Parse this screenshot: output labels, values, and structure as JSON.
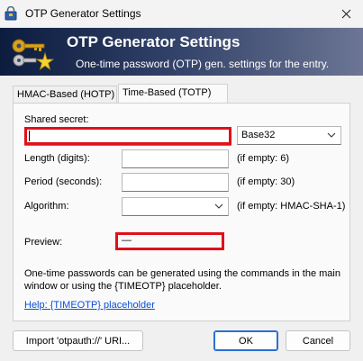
{
  "window": {
    "title": "OTP Generator Settings"
  },
  "banner": {
    "title": "OTP Generator Settings",
    "subtitle": "One-time password (OTP) gen. settings for the entry."
  },
  "tabs": [
    {
      "label": "HMAC-Based (HOTP)",
      "selected": false
    },
    {
      "label": "Time-Based (TOTP)",
      "selected": true
    }
  ],
  "form": {
    "shared_secret_label": "Shared secret:",
    "shared_secret_value": "",
    "encoding_value": "Base32",
    "length_label": "Length (digits):",
    "length_value": "",
    "length_hint": "(if empty: 6)",
    "period_label": "Period (seconds):",
    "period_value": "",
    "period_hint": "(if empty: 30)",
    "algorithm_label": "Algorithm:",
    "algorithm_value": "",
    "algorithm_hint": "(if empty: HMAC-SHA-1)",
    "preview_label": "Preview:",
    "preview_value": "—"
  },
  "info_text": "One-time passwords can be generated using the commands in the main window or using the {TIMEOTP} placeholder.",
  "help_link": "Help: {TIMEOTP} placeholder",
  "buttons": {
    "import_label": "Import 'otpauth://' URI...",
    "ok_label": "OK",
    "cancel_label": "Cancel"
  },
  "colors": {
    "highlight": "#e0101a",
    "link": "#0a4fd8",
    "banner_start": "#0c1c3e",
    "banner_end": "#6c7594"
  },
  "icons": {
    "window": "keepass-lock-icon",
    "close": "close-icon",
    "banner": "key-star-icon",
    "dropdown": "chevron-down-icon"
  }
}
